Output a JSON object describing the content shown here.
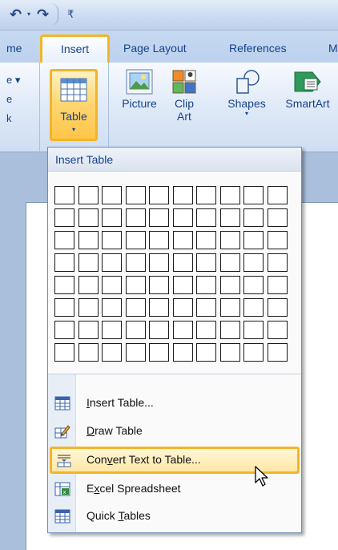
{
  "quick_access": {
    "undo_glyph": "↶",
    "dropdown_glyph": "▾",
    "redo_glyph": "↷",
    "customize_glyph": "₹"
  },
  "tabs": {
    "home": "me",
    "insert": "Insert",
    "page_layout": "Page Layout",
    "references": "References",
    "more": "M"
  },
  "ribbon": {
    "left_group_lines": [
      "e ▾",
      "e",
      "k"
    ],
    "table_button": {
      "label": "Table",
      "arrow": "▾"
    },
    "picture_button": {
      "label": "Picture"
    },
    "clip_art_button": {
      "label_line1": "Clip",
      "label_line2": "Art"
    },
    "shapes_button": {
      "label": "Shapes",
      "arrow": "▾"
    },
    "smartart_button": {
      "label": "SmartArt"
    }
  },
  "dropdown": {
    "header": "Insert Table",
    "grid": {
      "columns": 10,
      "rows": 8
    },
    "items": [
      {
        "name": "insert-table",
        "pre": "",
        "key": "I",
        "post": "nsert Table...",
        "icon": "table-grid-icon"
      },
      {
        "name": "draw-table",
        "pre": "",
        "key": "D",
        "post": "raw Table",
        "icon": "pencil-icon"
      },
      {
        "name": "convert-text-to-table",
        "pre": "Con",
        "key": "v",
        "post": "ert Text to Table...",
        "icon": "convert-text-icon"
      },
      {
        "name": "excel-spreadsheet",
        "pre": "E",
        "key": "x",
        "post": "cel Spreadsheet",
        "icon": "excel-icon"
      },
      {
        "name": "quick-tables",
        "pre": "Quick ",
        "key": "T",
        "post": "ables",
        "icon": "quick-table-icon"
      }
    ]
  },
  "colors": {
    "accent_highlight": "#f4b42a",
    "ribbon_text": "#15428b",
    "menu_text": "#111111"
  }
}
